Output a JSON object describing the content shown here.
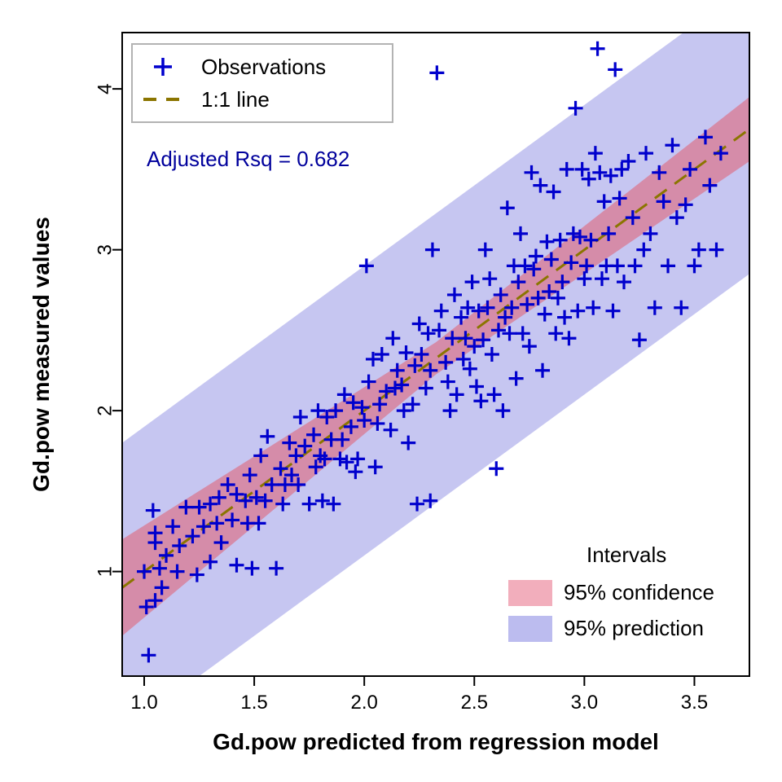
{
  "chart_data": {
    "type": "scatter",
    "title": "",
    "xlabel": "Gd.pow predicted from regression model",
    "ylabel": "Gd.pow measured values",
    "xlim": [
      0.9,
      3.75
    ],
    "ylim": [
      0.35,
      4.35
    ],
    "x_ticks": [
      1.0,
      1.5,
      2.0,
      2.5,
      3.0,
      3.5
    ],
    "y_ticks": [
      1,
      2,
      3,
      4
    ],
    "annotation": "Adjusted Rsq = 0.682",
    "legend_top": {
      "items": [
        {
          "label": "Observations",
          "marker": "plus",
          "color": "#0000cd"
        },
        {
          "label": "1:1 line",
          "marker": "dash",
          "color": "#8b7500"
        }
      ]
    },
    "legend_bottom": {
      "title": "Intervals",
      "items": [
        {
          "label": "95% confidence",
          "swatch": "#f0a0b0"
        },
        {
          "label": "95% prediction",
          "swatch": "#b0b0ec"
        }
      ]
    },
    "line_1to1": {
      "x0": 0.9,
      "y0": 0.9,
      "x1": 3.75,
      "y1": 3.75
    },
    "confidence_band": {
      "half_width_at_xmin": 0.3,
      "half_width_at_xmid": 0.1,
      "half_width_at_xmax": 0.2
    },
    "prediction_band": {
      "half_width": 0.9
    },
    "series": [
      {
        "name": "Observations",
        "x": [
          1.01,
          1.0,
          1.02,
          1.05,
          1.07,
          1.05,
          1.04,
          1.05,
          1.08,
          1.1,
          1.13,
          1.15,
          1.16,
          1.19,
          1.22,
          1.24,
          1.25,
          1.27,
          1.3,
          1.3,
          1.33,
          1.34,
          1.35,
          1.38,
          1.4,
          1.42,
          1.42,
          1.46,
          1.47,
          1.48,
          1.49,
          1.51,
          1.52,
          1.53,
          1.55,
          1.56,
          1.58,
          1.6,
          1.62,
          1.63,
          1.64,
          1.66,
          1.67,
          1.69,
          1.7,
          1.71,
          1.73,
          1.75,
          1.77,
          1.78,
          1.79,
          1.8,
          1.81,
          1.82,
          1.83,
          1.85,
          1.86,
          1.87,
          1.89,
          1.9,
          1.91,
          1.92,
          1.94,
          1.95,
          1.96,
          1.97,
          1.99,
          2.0,
          2.01,
          2.02,
          2.04,
          2.05,
          2.06,
          2.07,
          2.08,
          2.1,
          2.12,
          2.13,
          2.14,
          2.15,
          2.17,
          2.18,
          2.19,
          2.2,
          2.22,
          2.23,
          2.24,
          2.25,
          2.26,
          2.28,
          2.29,
          2.3,
          2.31,
          2.33,
          2.34,
          2.35,
          2.37,
          2.38,
          2.39,
          2.4,
          2.41,
          2.42,
          2.3,
          2.44,
          2.45,
          2.46,
          2.47,
          2.48,
          2.49,
          2.5,
          2.51,
          2.52,
          2.53,
          2.54,
          2.55,
          2.56,
          2.57,
          2.58,
          2.59,
          2.6,
          2.61,
          2.62,
          2.63,
          2.64,
          2.65,
          2.66,
          2.67,
          2.68,
          2.69,
          2.7,
          2.71,
          2.72,
          2.73,
          2.74,
          2.75,
          2.76,
          2.77,
          2.78,
          2.79,
          2.8,
          2.81,
          2.82,
          2.83,
          2.84,
          2.85,
          2.86,
          2.87,
          2.88,
          2.89,
          2.9,
          2.91,
          2.92,
          2.93,
          2.94,
          2.95,
          2.96,
          2.97,
          2.98,
          2.99,
          3.0,
          3.01,
          3.02,
          3.03,
          3.04,
          3.05,
          3.06,
          3.07,
          3.08,
          3.09,
          3.1,
          3.11,
          3.12,
          3.13,
          3.14,
          3.15,
          3.16,
          3.17,
          3.18,
          3.2,
          3.22,
          3.23,
          3.25,
          3.27,
          3.28,
          3.3,
          3.32,
          3.34,
          3.36,
          3.38,
          3.4,
          3.42,
          3.44,
          3.46,
          3.48,
          3.5,
          3.52,
          3.55,
          3.57,
          3.6,
          3.62
        ],
        "y": [
          0.78,
          1.0,
          0.48,
          0.82,
          1.02,
          1.18,
          1.38,
          1.24,
          0.9,
          1.1,
          1.28,
          1.0,
          1.16,
          1.4,
          1.22,
          0.98,
          1.4,
          1.28,
          1.06,
          1.42,
          1.3,
          1.46,
          1.18,
          1.54,
          1.32,
          1.04,
          1.48,
          1.44,
          1.3,
          1.6,
          1.02,
          1.46,
          1.3,
          1.72,
          1.44,
          1.84,
          1.54,
          1.02,
          1.64,
          1.42,
          1.54,
          1.8,
          1.6,
          1.72,
          1.54,
          1.96,
          1.78,
          1.42,
          1.85,
          1.65,
          2.0,
          1.72,
          1.44,
          1.7,
          1.96,
          1.82,
          1.42,
          2.0,
          1.7,
          1.82,
          2.1,
          1.68,
          1.9,
          2.05,
          1.62,
          1.7,
          2.02,
          1.94,
          2.9,
          2.18,
          2.32,
          1.65,
          1.92,
          2.04,
          2.35,
          2.12,
          1.88,
          2.45,
          2.14,
          2.25,
          2.16,
          2.0,
          2.36,
          1.8,
          2.04,
          2.28,
          1.42,
          2.54,
          2.35,
          2.14,
          2.48,
          2.25,
          3.0,
          4.1,
          2.5,
          2.62,
          2.3,
          2.18,
          2.0,
          2.45,
          2.72,
          2.1,
          1.44,
          2.58,
          2.32,
          2.45,
          2.64,
          2.26,
          2.8,
          2.4,
          2.15,
          2.62,
          2.06,
          2.44,
          3.0,
          2.64,
          2.82,
          2.35,
          2.1,
          1.64,
          2.5,
          2.72,
          2.0,
          2.58,
          3.26,
          2.48,
          2.64,
          2.9,
          2.2,
          2.8,
          3.1,
          2.48,
          2.9,
          2.66,
          2.4,
          3.48,
          2.88,
          2.96,
          2.7,
          3.4,
          2.25,
          2.6,
          3.05,
          2.74,
          2.94,
          3.36,
          2.48,
          2.7,
          3.06,
          2.8,
          2.58,
          3.5,
          2.45,
          2.92,
          3.1,
          3.88,
          2.62,
          3.08,
          3.5,
          2.82,
          2.9,
          3.44,
          3.06,
          2.64,
          3.6,
          4.25,
          3.48,
          2.82,
          3.3,
          2.9,
          3.1,
          3.46,
          2.62,
          4.12,
          2.9,
          3.32,
          3.5,
          2.8,
          3.55,
          3.2,
          2.9,
          2.44,
          3.0,
          3.6,
          3.1,
          2.64,
          3.48,
          3.3,
          2.9,
          3.65,
          3.2,
          2.64,
          3.28,
          3.5,
          2.9,
          3.0,
          3.7,
          3.4,
          3.0,
          3.6
        ]
      }
    ]
  }
}
